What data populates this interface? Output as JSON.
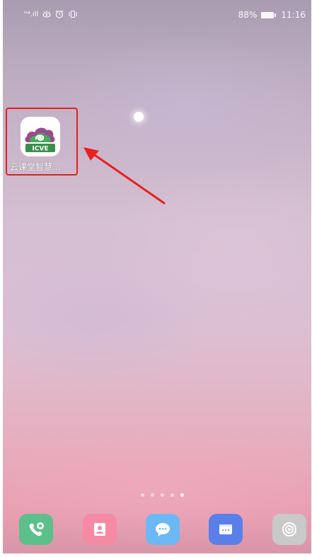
{
  "status_bar": {
    "signal_text": "ᴴ⁴.ıll",
    "icons_left": [
      "signal-icon",
      "eye-comfort-icon",
      "alarm-icon",
      "vibrate-icon"
    ],
    "battery_percent": "88%",
    "time": "11:16"
  },
  "home": {
    "app": {
      "label": "云课堂智慧...",
      "logo_text": "ICVE",
      "icon": "icve-app-icon",
      "highlighted": true,
      "highlight_color": "#e02020"
    },
    "pages": {
      "count": 5,
      "active_index": 4
    }
  },
  "dock": {
    "items": [
      {
        "name": "phone",
        "icon": "phone-icon",
        "color": "#5bc08a"
      },
      {
        "name": "contacts",
        "icon": "contacts-icon",
        "color": "#f58aa4"
      },
      {
        "name": "messages",
        "icon": "messages-icon",
        "color": "#6cb8f5"
      },
      {
        "name": "browser",
        "icon": "browser-icon",
        "color": "#5b7fe8"
      },
      {
        "name": "camera",
        "icon": "camera-icon",
        "color": "#c9c9c9"
      }
    ]
  }
}
